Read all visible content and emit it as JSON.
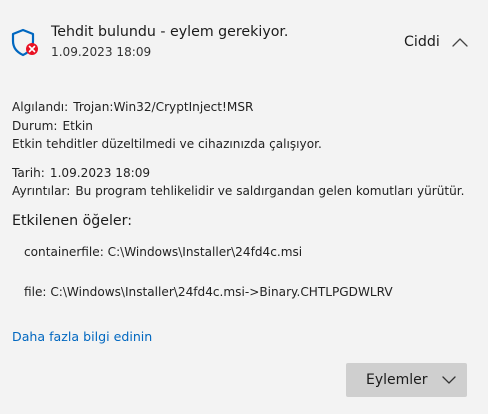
{
  "header": {
    "title": "Tehdit bulundu - eylem gerekiyor.",
    "datetime": "1.09.2023 18:09",
    "severity": "Ciddi",
    "icon": "shield-warning-icon",
    "accent": "#0067c0",
    "alert_color": "#e81123"
  },
  "details": {
    "detected_label": "Algılandı:",
    "detected_value": "Trojan:Win32/CryptInject!MSR",
    "status_label": "Durum:",
    "status_value": "Etkin",
    "status_note": "Etkin tehditler düzeltilmedi ve cihazınızda çalışıyor.",
    "date_label": "Tarih:",
    "date_value": "1.09.2023 18:09",
    "details_label": "Ayrıntılar:",
    "details_value": "Bu program tehlikelidir ve saldırgandan gelen komutları yürütür."
  },
  "affected": {
    "title": "Etkilenen öğeler:",
    "items": [
      "containerfile: C:\\Windows\\Installer\\24fd4c.msi",
      "file: C:\\Windows\\Installer\\24fd4c.msi->Binary.CHTLPGDWLRV"
    ]
  },
  "learn_more": "Daha fazla bilgi edinin",
  "actions_button": "Eylemler"
}
